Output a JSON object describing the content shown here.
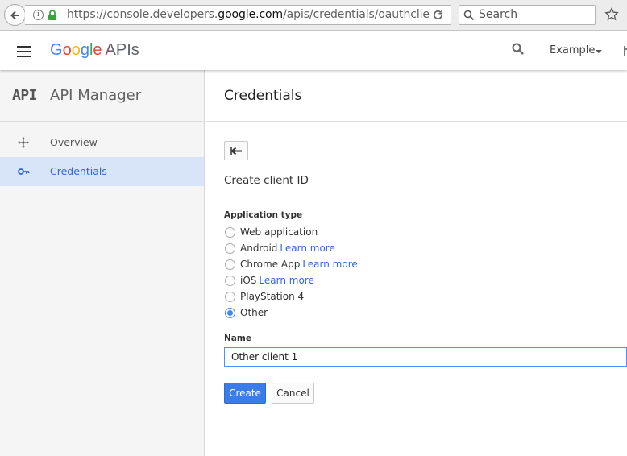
{
  "browser": {
    "url_prefix": "https://console.developers.",
    "url_domain": "google.com",
    "url_suffix": "/apis/credentials/oauthclie",
    "search_placeholder": "Search"
  },
  "header": {
    "logo_letters": [
      "G",
      "o",
      "o",
      "g",
      "l",
      "e"
    ],
    "logo_suffix": "APIs",
    "project": "Example"
  },
  "sidebar": {
    "mark": "API",
    "title": "API Manager",
    "items": [
      {
        "label": "Overview",
        "icon": "overview-icon",
        "active": false
      },
      {
        "label": "Credentials",
        "icon": "key-icon",
        "active": true
      }
    ]
  },
  "main": {
    "title": "Credentials",
    "subtitle": "Create client ID",
    "application_type_label": "Application type",
    "options": [
      {
        "label": "Web application",
        "link": "",
        "selected": false
      },
      {
        "label": "Android",
        "link": "Learn more",
        "selected": false
      },
      {
        "label": "Chrome App",
        "link": "Learn more",
        "selected": false
      },
      {
        "label": "iOS",
        "link": "Learn more",
        "selected": false
      },
      {
        "label": "PlayStation 4",
        "link": "",
        "selected": false
      },
      {
        "label": "Other",
        "link": "",
        "selected": true
      }
    ],
    "name_label": "Name",
    "name_value": "Other client 1",
    "create_label": "Create",
    "cancel_label": "Cancel"
  },
  "colors": {
    "accent": "#3b7de8",
    "active_nav_bg": "#d8e4f8",
    "link": "#3367d6"
  }
}
